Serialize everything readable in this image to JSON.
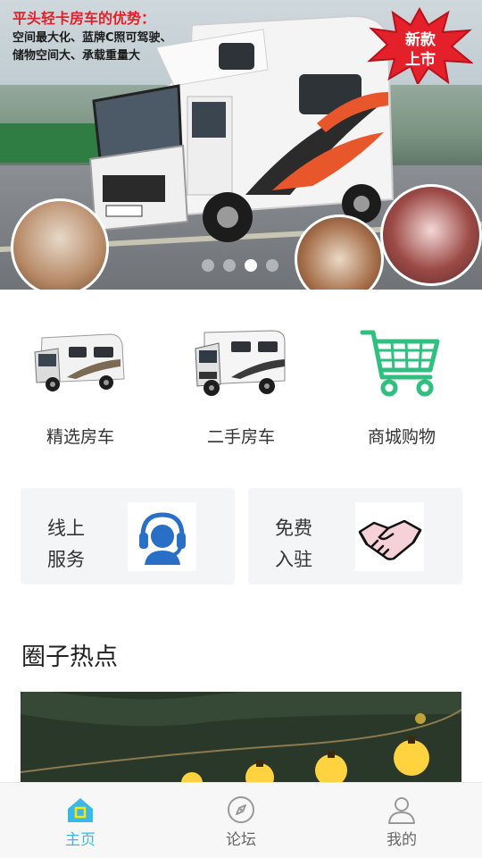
{
  "banner": {
    "headline": "平头轻卡房车的优势：",
    "subline1": "空间最大化、蓝牌C照可驾驶、",
    "subline2": "储物空间大、承载重量大",
    "badge_line1": "新款",
    "badge_line2": "上市",
    "pager": {
      "count": 4,
      "active_index": 2
    }
  },
  "categories": [
    {
      "label": "精选房车",
      "icon": "rv-icon"
    },
    {
      "label": "二手房车",
      "icon": "rv-icon"
    },
    {
      "label": "商城购物",
      "icon": "shopping-cart-icon"
    }
  ],
  "services": {
    "online": {
      "line1": "线上",
      "line2": "服务",
      "icon": "customer-service-icon"
    },
    "join": {
      "line1": "免费",
      "line2": "入驻",
      "icon": "handshake-icon"
    }
  },
  "section": {
    "title": "圈子热点"
  },
  "tabbar": {
    "items": [
      {
        "label": "主页",
        "icon": "home-icon",
        "active": true
      },
      {
        "label": "论坛",
        "icon": "compass-icon",
        "active": false
      },
      {
        "label": "我的",
        "icon": "user-icon",
        "active": false
      }
    ]
  },
  "colors": {
    "accent": "#3bb9e6",
    "cart_green": "#2fc07f",
    "headset_blue": "#2a6fc7",
    "headline_red": "#e3202a",
    "card_bg": "#f4f5f7"
  }
}
